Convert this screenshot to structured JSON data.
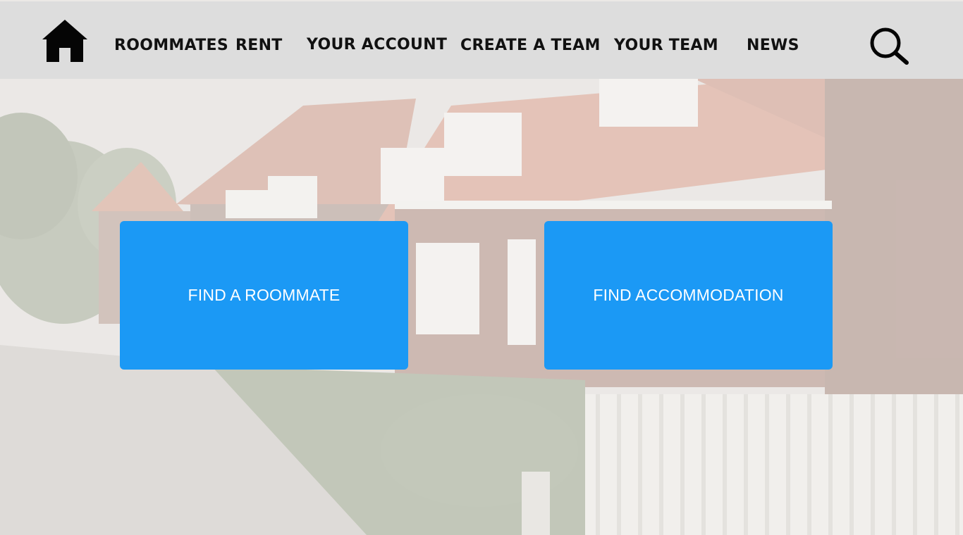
{
  "nav": {
    "home_icon": "home-icon",
    "items": [
      {
        "label": "ROOMMATES"
      },
      {
        "label": "RENT"
      },
      {
        "label": "YOUR ACCOUNT"
      },
      {
        "label": "CREATE A TEAM"
      },
      {
        "label": "YOUR TEAM"
      },
      {
        "label": "NEWS"
      }
    ],
    "search_icon": "search-icon"
  },
  "actions": {
    "find_roommate": "FIND A ROOMMATE",
    "find_accommodation": "FIND ACCOMMODATION"
  },
  "colors": {
    "navbar_bg": "#dddddd",
    "tile_bg": "#1b99f5",
    "tile_text": "#ffffff",
    "nav_text": "#111111"
  }
}
